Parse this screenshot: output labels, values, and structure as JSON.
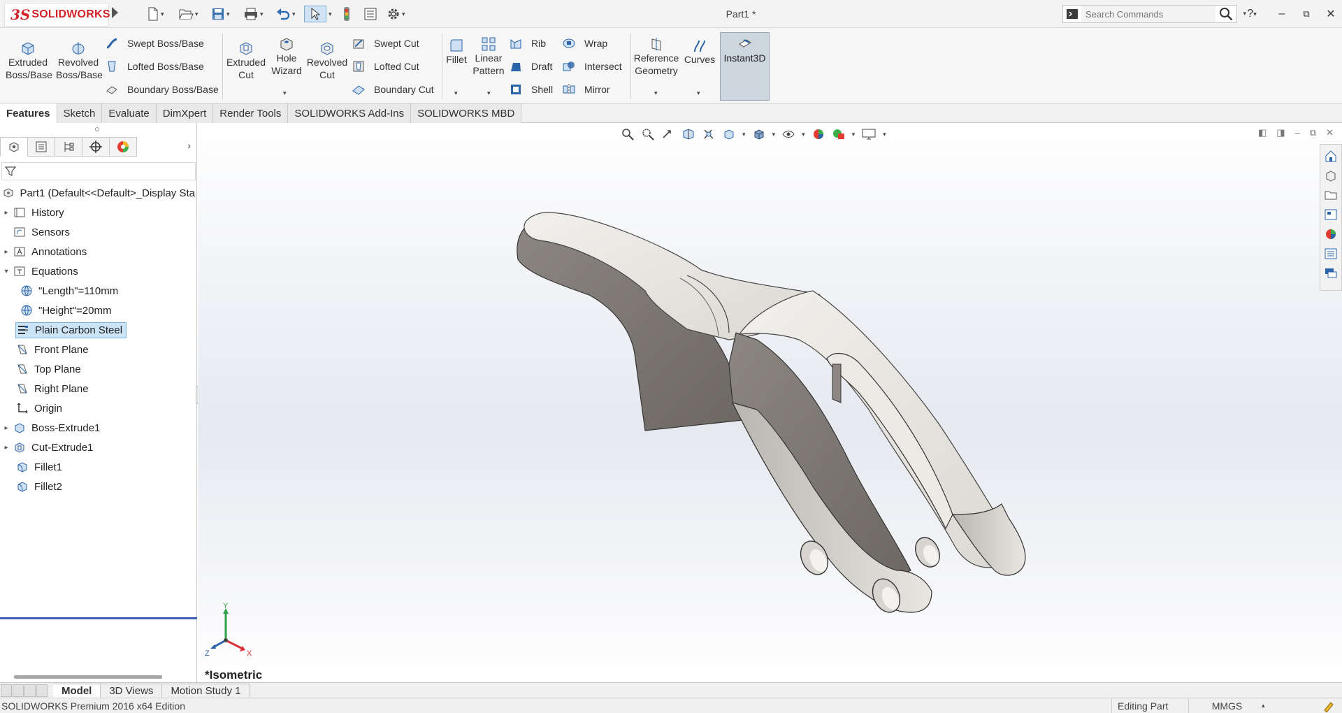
{
  "app": {
    "brand_ds": "3S",
    "brand_name": "SOLIDWORKS",
    "doc_title": "Part1 *"
  },
  "search": {
    "placeholder": "Search Commands"
  },
  "ribbon": {
    "extruded_boss": [
      "Extruded",
      "Boss/Base"
    ],
    "revolved_boss": [
      "Revolved",
      "Boss/Base"
    ],
    "swept_boss": "Swept Boss/Base",
    "lofted_boss": "Lofted Boss/Base",
    "boundary_boss": "Boundary Boss/Base",
    "extruded_cut": [
      "Extruded",
      "Cut"
    ],
    "hole_wizard": [
      "Hole",
      "Wizard"
    ],
    "revolved_cut": [
      "Revolved",
      "Cut"
    ],
    "swept_cut": "Swept Cut",
    "lofted_cut": "Lofted Cut",
    "boundary_cut": "Boundary Cut",
    "fillet": "Fillet",
    "linear_pattern": [
      "Linear",
      "Pattern"
    ],
    "rib": "Rib",
    "draft": "Draft",
    "shell": "Shell",
    "wrap": "Wrap",
    "intersect": "Intersect",
    "mirror": "Mirror",
    "reference_geometry": [
      "Reference",
      "Geometry"
    ],
    "curves": "Curves",
    "instant3d": "Instant3D"
  },
  "command_tabs": [
    "Features",
    "Sketch",
    "Evaluate",
    "DimXpert",
    "Render Tools",
    "SOLIDWORKS Add-Ins",
    "SOLIDWORKS MBD"
  ],
  "tree": {
    "root": "Part1  (Default<<Default>_Display Sta",
    "history": "History",
    "sensors": "Sensors",
    "annotations": "Annotations",
    "equations": "Equations",
    "eq_length": "\"Length\"=110mm",
    "eq_height": "\"Height\"=20mm",
    "material": "Plain Carbon Steel",
    "front_plane": "Front Plane",
    "top_plane": "Top Plane",
    "right_plane": "Right Plane",
    "origin": "Origin",
    "boss_extrude": "Boss-Extrude1",
    "cut_extrude": "Cut-Extrude1",
    "fillet1": "Fillet1",
    "fillet2": "Fillet2"
  },
  "viewport": {
    "view_name": "*Isometric",
    "axis_x": "X",
    "axis_y": "Y",
    "axis_z": "Z"
  },
  "bottom_tabs": [
    "Model",
    "3D Views",
    "Motion Study 1"
  ],
  "status": {
    "edition": "SOLIDWORKS Premium 2016 x64 Edition",
    "mode": "Editing Part",
    "units": "MMGS"
  },
  "colors": {
    "accent": "#d2232a",
    "selection": "#cce4f7",
    "rollback": "#3b5fb0"
  }
}
